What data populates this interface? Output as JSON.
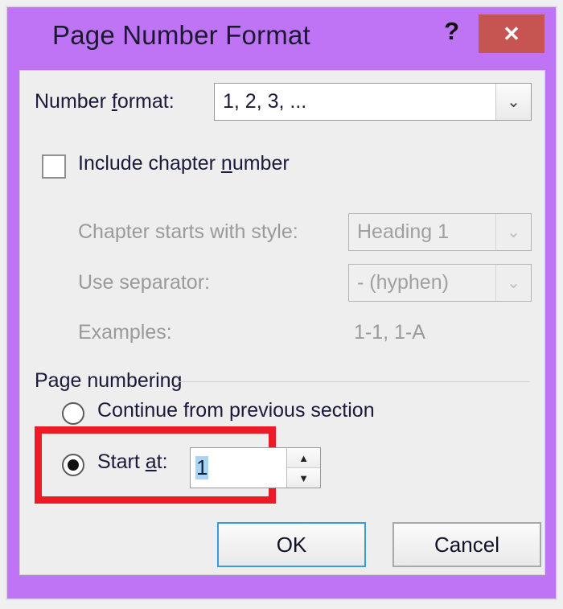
{
  "dialog": {
    "title": "Page Number Format",
    "help_icon": "?",
    "close_icon": "✕",
    "colors": {
      "titlebar": "#bf74f5",
      "close_button": "#c65450",
      "annotation": "#ed1c24",
      "selection": "#a8d4f5",
      "default_button_border": "#3a9bdc"
    }
  },
  "number_format": {
    "label_before": "Number ",
    "label_accel": "f",
    "label_after": "ormat:",
    "value": "1, 2, 3, ...",
    "dropdown_icon": "⌄"
  },
  "include_chapter": {
    "label_before": "Include chapter ",
    "label_accel": "n",
    "label_after": "umber",
    "checked": false
  },
  "chapter_style": {
    "label": "Chapter starts with style:",
    "value": "Heading 1",
    "dropdown_icon": "⌄",
    "disabled": true
  },
  "separator": {
    "label": "Use separator:",
    "value": "-   (hyphen)",
    "dropdown_icon": "⌄",
    "disabled": true
  },
  "examples": {
    "label": "Examples:",
    "value": "1-1, 1-A"
  },
  "page_numbering": {
    "group_label": "Page numbering",
    "continue_option": {
      "label": "Continue from previous section",
      "selected": false
    },
    "start_at_option": {
      "label_before": "Start ",
      "label_accel": "a",
      "label_after": "t:",
      "selected": true,
      "value": "1",
      "up_icon": "▲",
      "down_icon": "▼"
    }
  },
  "footer": {
    "ok_label": "OK",
    "cancel_label": "Cancel"
  }
}
